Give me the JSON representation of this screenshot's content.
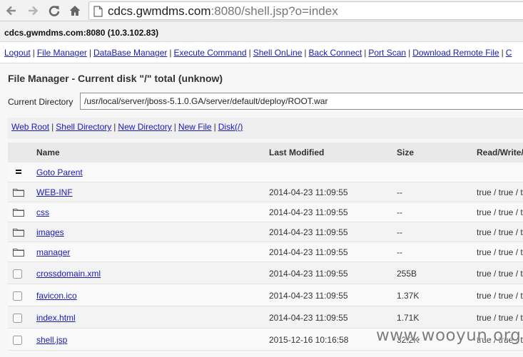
{
  "browser": {
    "url_host": "cdcs.gwmdms.com",
    "url_rest": ":8080/shell.jsp?o=index"
  },
  "host_line": "cdcs.gwmdms.com:8080 (10.3.102.83)",
  "menu": {
    "items": [
      "Logout",
      "File Manager",
      "DataBase Manager",
      "Execute Command",
      "Shell OnLine",
      "Back Connect",
      "Port Scan",
      "Download Remote File",
      "C"
    ],
    "separator": "|"
  },
  "file_manager": {
    "title": "File Manager - Current disk \"/\" total (unknow)",
    "current_dir_label": "Current Directory",
    "current_dir_value": "/usr/local/server/jboss-5.1.0.GA/server/default/deploy/ROOT.war",
    "quick_links": [
      "Web Root",
      "Shell Directory",
      "New Directory",
      "New File",
      "Disk(/)"
    ],
    "columns": {
      "name": "Name",
      "modified": "Last Modified",
      "size": "Size",
      "rw": "Read/Write/"
    },
    "parent_label": "Goto Parent",
    "rows": [
      {
        "name": "WEB-INF",
        "modified": "2014-04-23 11:09:55",
        "size": "--",
        "rw": "true / true / tru",
        "type": "folder-icon"
      },
      {
        "name": "css",
        "modified": "2014-04-23 11:09:55",
        "size": "--",
        "rw": "true / true / tru",
        "type": "folder-icon"
      },
      {
        "name": "images",
        "modified": "2014-04-23 11:09:55",
        "size": "--",
        "rw": "true / true / tru",
        "type": "folder-icon"
      },
      {
        "name": "manager",
        "modified": "2014-04-23 11:09:55",
        "size": "--",
        "rw": "true / true / tru",
        "type": "folder-icon"
      },
      {
        "name": "crossdomain.xml",
        "modified": "2014-04-23 11:09:55",
        "size": "255B",
        "rw": "true / true / tru",
        "type": "checkbox"
      },
      {
        "name": "favicon.ico",
        "modified": "2014-04-23 11:09:55",
        "size": "1.37K",
        "rw": "true / true / tru",
        "type": "checkbox"
      },
      {
        "name": "index.html",
        "modified": "2014-04-23 11:09:55",
        "size": "1.71K",
        "rw": "true / true / tru",
        "type": "checkbox"
      },
      {
        "name": "shell.jsp",
        "modified": "2015-12-16 10:16:58",
        "size": "32.2K",
        "rw": "true / true / tru",
        "type": "checkbox"
      }
    ]
  },
  "watermark": "www.wooyun.org",
  "icons": [
    "back-icon",
    "forward-icon",
    "reload-icon",
    "home-icon",
    "page-icon",
    "folder-icon",
    "goto-parent-icon"
  ]
}
